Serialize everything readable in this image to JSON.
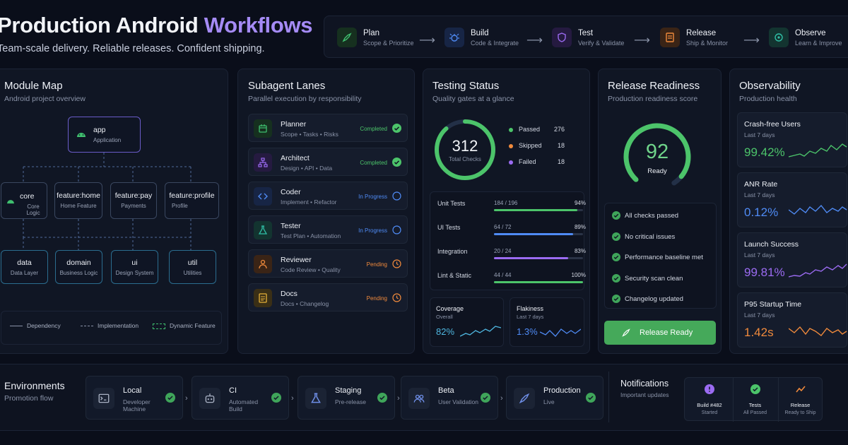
{
  "hero": {
    "title_main": "Production Android ",
    "title_accent": "Workflows",
    "subtitle": "Team-scale delivery. Reliable releases. Confident shipping."
  },
  "pipeline": [
    {
      "name": "Plan",
      "desc": "Scope & Prioritize",
      "icon": "rocket-icon",
      "color": "#3fbf6f"
    },
    {
      "name": "Build",
      "desc": "Code & Integrate",
      "icon": "bug-icon",
      "color": "#4f8bf5"
    },
    {
      "name": "Test",
      "desc": "Verify & Validate",
      "icon": "shield-icon",
      "color": "#9b6bf2"
    },
    {
      "name": "Release",
      "desc": "Ship & Monitor",
      "icon": "release-doc-icon",
      "color": "#f08a3c"
    },
    {
      "name": "Observe",
      "desc": "Learn & Improve",
      "icon": "target-icon",
      "color": "#2fbfa6"
    }
  ],
  "module_map": {
    "title": "Module Map",
    "subtitle": "Android project overview",
    "app": {
      "name": "app",
      "desc": "Application"
    },
    "features": [
      {
        "name": "core",
        "desc": "Core Logic"
      },
      {
        "name": "feature:home",
        "desc": "Home Feature"
      },
      {
        "name": "feature:pay",
        "desc": "Payments"
      },
      {
        "name": "feature:profile",
        "desc": "Profile"
      }
    ],
    "layers": [
      {
        "name": "data",
        "desc": "Data Layer"
      },
      {
        "name": "domain",
        "desc": "Business Logic"
      },
      {
        "name": "ui",
        "desc": "Design System"
      },
      {
        "name": "util",
        "desc": "Utilities"
      }
    ],
    "legend": [
      "Dependency",
      "Implementation",
      "Dynamic Feature"
    ]
  },
  "lanes": {
    "title": "Subagent Lanes",
    "subtitle": "Parallel execution by responsibility",
    "items": [
      {
        "name": "Planner",
        "desc": "Scope • Tasks • Risks",
        "status": "Completed",
        "icon": "calendar-icon",
        "color": "#3fbf6f"
      },
      {
        "name": "Architect",
        "desc": "Design • API • Data",
        "status": "Completed",
        "icon": "hierarchy-icon",
        "color": "#9b6bf2"
      },
      {
        "name": "Coder",
        "desc": "Implement • Refactor",
        "status": "In Progress",
        "icon": "code-icon",
        "color": "#4f8bf5"
      },
      {
        "name": "Tester",
        "desc": "Test Plan • Automation",
        "status": "In Progress",
        "icon": "flask-icon",
        "color": "#2fbfa6"
      },
      {
        "name": "Reviewer",
        "desc": "Code Review • Quality",
        "status": "Pending",
        "icon": "person-icon",
        "color": "#f08a3c"
      },
      {
        "name": "Docs",
        "desc": "Docs • Changelog",
        "status": "Pending",
        "icon": "document-icon",
        "color": "#e8b23a"
      }
    ]
  },
  "testing": {
    "title": "Testing Status",
    "subtitle": "Quality gates at a glance",
    "total": "312",
    "total_label": "Total Checks",
    "counts": [
      {
        "label": "Passed",
        "value": "276",
        "color": "#4cc46a"
      },
      {
        "label": "Skipped",
        "value": "18",
        "color": "#f08a3c"
      },
      {
        "label": "Failed",
        "value": "18",
        "color": "#9b6bf2"
      }
    ],
    "rows": [
      {
        "name": "Unit Tests",
        "ratio": "184 / 196",
        "pct": "94%",
        "fill": 0.94,
        "color": "#4cc46a"
      },
      {
        "name": "UI Tests",
        "ratio": "64 / 72",
        "pct": "89%",
        "fill": 0.89,
        "color": "#4f8bf5"
      },
      {
        "name": "Integration",
        "ratio": "20 / 24",
        "pct": "83%",
        "fill": 0.83,
        "color": "#9b6bf2"
      },
      {
        "name": "Lint & Static",
        "ratio": "44 / 44",
        "pct": "100%",
        "fill": 1.0,
        "color": "#4cc46a"
      }
    ],
    "coverage": {
      "title": "Coverage",
      "sub": "Overall",
      "value": "82%"
    },
    "flakiness": {
      "title": "Flakiness",
      "sub": "Last 7 days",
      "value": "1.3%"
    }
  },
  "release": {
    "title": "Release Readiness",
    "subtitle": "Production readiness score",
    "score": "92",
    "score_value": 0.92,
    "score_label": "Ready",
    "checks": [
      "All checks passed",
      "No critical issues",
      "Performance baseline met",
      "Security scan clean",
      "Changelog updated"
    ],
    "button": "Release Ready"
  },
  "observability": {
    "title": "Observability",
    "subtitle": "Production health",
    "metrics": [
      {
        "name": "Crash-free Users",
        "period": "Last 7 days",
        "value": "99.42%",
        "color": "#4cc46a"
      },
      {
        "name": "ANR Rate",
        "period": "Last 7 days",
        "value": "0.12%",
        "color": "#4f8bf5"
      },
      {
        "name": "Launch Success",
        "period": "Last 7 days",
        "value": "99.81%",
        "color": "#9b6bf2"
      },
      {
        "name": "P95 Startup Time",
        "period": "Last 7 days",
        "value": "1.42s",
        "color": "#f08a3c"
      }
    ]
  },
  "environments": {
    "title": "Environments",
    "subtitle": "Promotion flow",
    "items": [
      {
        "name": "Local",
        "desc1": "Developer",
        "desc2": "Machine",
        "icon": "terminal-icon"
      },
      {
        "name": "CI",
        "desc1": "Automated",
        "desc2": "Build",
        "icon": "robot-icon"
      },
      {
        "name": "Staging",
        "desc1": "Pre-release",
        "desc2": "",
        "icon": "flask-icon"
      },
      {
        "name": "Beta",
        "desc1": "User Validation",
        "desc2": "",
        "icon": "users-icon"
      },
      {
        "name": "Production",
        "desc1": "Live",
        "desc2": "",
        "icon": "rocket-icon"
      }
    ]
  },
  "notifications": {
    "title": "Notifications",
    "subtitle": "Important updates",
    "items": [
      {
        "title": "Build #482",
        "desc": "Started",
        "color": "#9b6bf2",
        "icon": "alert-icon"
      },
      {
        "title": "Tests",
        "desc": "All Passed",
        "color": "#4cc46a",
        "icon": "check-icon"
      },
      {
        "title": "Release",
        "desc": "Ready to Ship",
        "color": "#f08a3c",
        "icon": "chart-icon"
      }
    ]
  }
}
